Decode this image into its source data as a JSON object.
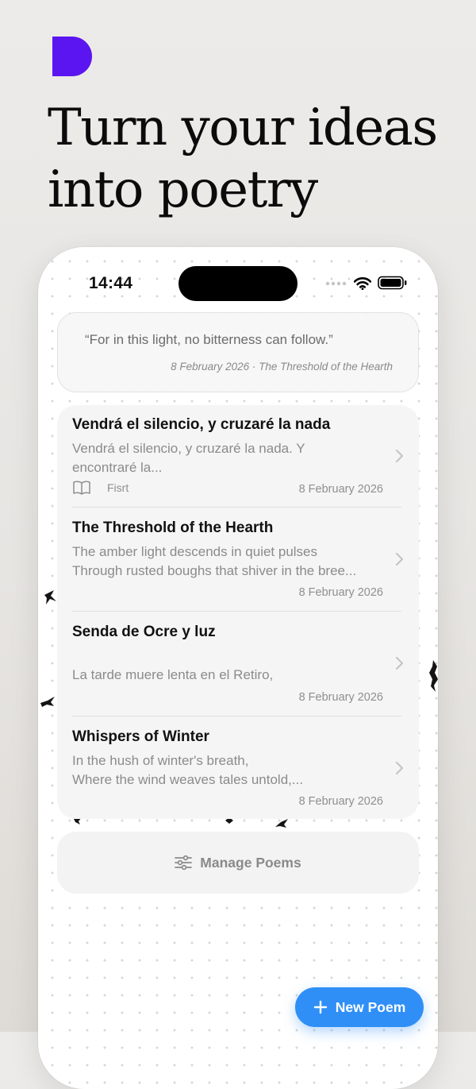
{
  "headline": {
    "line1": "Turn your ideas",
    "line2": "into poetry"
  },
  "brand_color": "#5b15f0",
  "status_bar": {
    "time": "14:44",
    "icons": [
      "signal-icon",
      "wifi-icon",
      "battery-icon"
    ]
  },
  "quote": {
    "text": "“For in this light, no bitterness can follow.”",
    "meta": "8 February 2026 · The Threshold of the Hearth"
  },
  "poems": [
    {
      "title": "Vendrá el silencio, y cruzaré la nada",
      "excerpt_line1": "Vendrá el silencio, y cruzaré la nada. Y",
      "excerpt_line2": "encontraré la...",
      "tag": "Fisrt",
      "tag_icon": "book-icon",
      "date": "8 February 2026"
    },
    {
      "title": "The Threshold of the Hearth",
      "excerpt_line1": "The amber light descends in quiet pulses",
      "excerpt_line2": "Through rusted boughs that shiver in the bree...",
      "date": "8 February 2026"
    },
    {
      "title": "Senda de Ocre y luz",
      "excerpt_line1": "",
      "excerpt_line2": "La tarde muere lenta en el Retiro,",
      "date": "8 February 2026"
    },
    {
      "title": "Whispers of Winter",
      "excerpt_line1": "In the hush of winter's breath,",
      "excerpt_line2": "Where the wind weaves tales untold,...",
      "date": "8 February 2026"
    }
  ],
  "manage_button": {
    "label": "Manage Poems",
    "icon": "sliders-icon"
  },
  "new_poem_button": {
    "label": "New Poem",
    "icon": "plus-icon",
    "color": "#2f8ff7"
  }
}
